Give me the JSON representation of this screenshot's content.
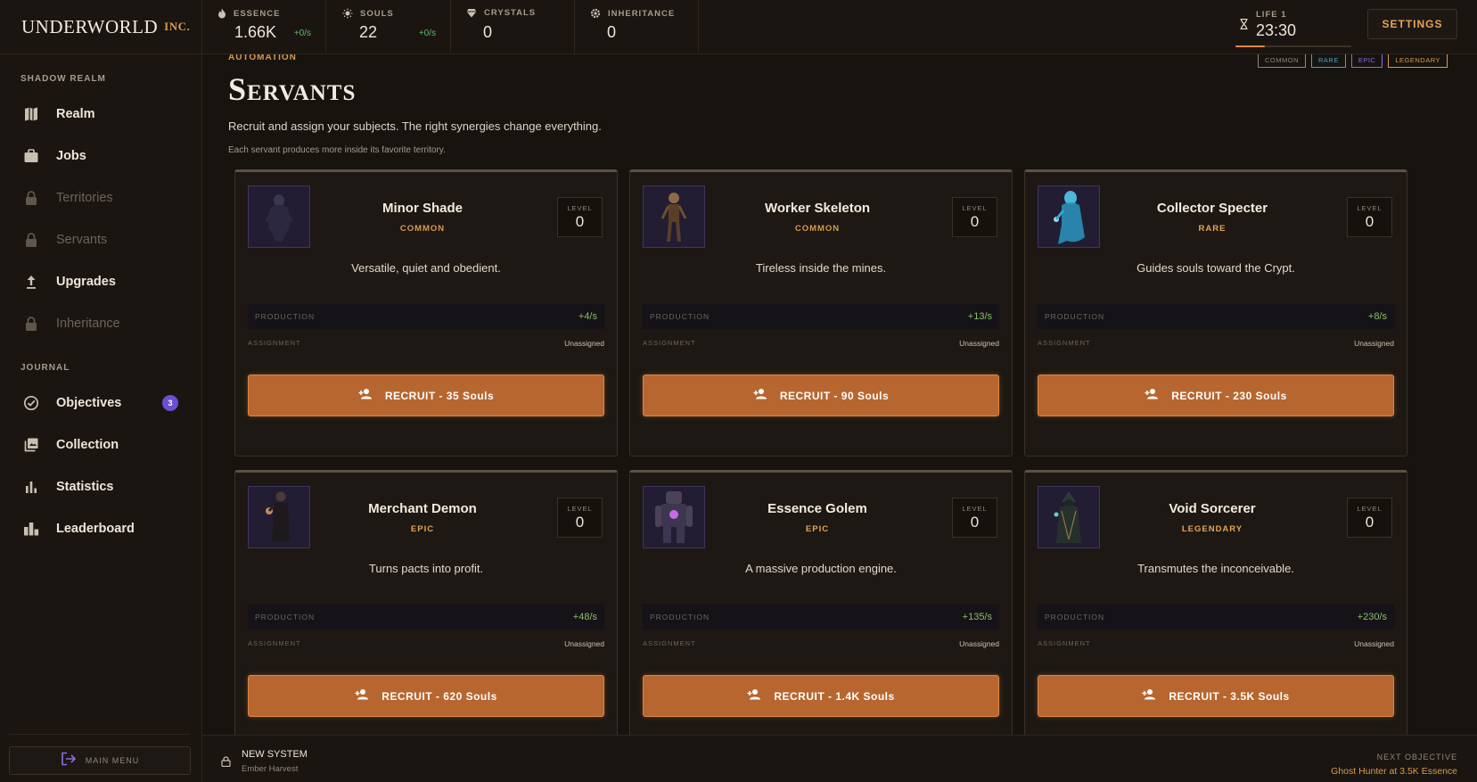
{
  "brand": {
    "main": "UNDERWORLD",
    "inc": "INC."
  },
  "nav": {
    "section1": "SHADOW REALM",
    "section2": "JOURNAL",
    "items": [
      {
        "label": "Realm",
        "icon": "map-icon",
        "locked": false
      },
      {
        "label": "Jobs",
        "icon": "briefcase-icon",
        "locked": false
      },
      {
        "label": "Territories",
        "icon": "lock-icon",
        "locked": true
      },
      {
        "label": "Servants",
        "icon": "lock-icon",
        "locked": true
      },
      {
        "label": "Upgrades",
        "icon": "upload-arrow-icon",
        "locked": false
      },
      {
        "label": "Inheritance",
        "icon": "lock-icon",
        "locked": true
      },
      {
        "label": "Objectives",
        "icon": "check-circle-icon",
        "locked": false,
        "badge": "3"
      },
      {
        "label": "Collection",
        "icon": "collection-icon",
        "locked": false
      },
      {
        "label": "Statistics",
        "icon": "bar-chart-icon",
        "locked": false
      },
      {
        "label": "Leaderboard",
        "icon": "leaderboard-icon",
        "locked": false
      }
    ],
    "main_menu": "MAIN MENU"
  },
  "resources": [
    {
      "name": "ESSENCE",
      "value": "1.66K",
      "rate": "+0/s",
      "icon": "flame-icon"
    },
    {
      "name": "SOULS",
      "value": "22",
      "rate": "+0/s",
      "icon": "sun-icon"
    },
    {
      "name": "CRYSTALS",
      "value": "0",
      "rate": "",
      "icon": "gem-icon"
    },
    {
      "name": "INHERITANCE",
      "value": "0",
      "rate": "",
      "icon": "gear-icon"
    }
  ],
  "life": {
    "label": "LIFE 1",
    "time": "23:30",
    "progress": 0.25
  },
  "settings_label": "SETTINGS",
  "page": {
    "kicker": "AUTOMATION",
    "title": "Servants",
    "subtitle": "Recruit and assign your subjects. The right synergies change everything.",
    "note": "Each servant produces more inside its favorite territory."
  },
  "legend": [
    {
      "label": "COMMON",
      "color": "#8f877b"
    },
    {
      "label": "RARE",
      "color": "#4f9fd6"
    },
    {
      "label": "EPIC",
      "color": "#8a6fe0"
    },
    {
      "label": "LEGENDARY",
      "color": "#d99a4f"
    }
  ],
  "labels": {
    "level": "LEVEL",
    "production": "PRODUCTION",
    "assignment": "ASSIGNMENT"
  },
  "servants": [
    {
      "name": "Minor Shade",
      "rarity": "COMMON",
      "level": "0",
      "desc": "Versatile, quiet and obedient.",
      "production": "+4/s",
      "assignment": "Unassigned",
      "recruit": "RECRUIT -  35 Souls"
    },
    {
      "name": "Worker Skeleton",
      "rarity": "COMMON",
      "level": "0",
      "desc": "Tireless inside the mines.",
      "production": "+13/s",
      "assignment": "Unassigned",
      "recruit": "RECRUIT -  90 Souls"
    },
    {
      "name": "Collector Specter",
      "rarity": "RARE",
      "level": "0",
      "desc": "Guides souls toward the Crypt.",
      "production": "+8/s",
      "assignment": "Unassigned",
      "recruit": "RECRUIT -  230 Souls"
    },
    {
      "name": "Merchant Demon",
      "rarity": "EPIC",
      "level": "0",
      "desc": "Turns pacts into profit.",
      "production": "+48/s",
      "assignment": "Unassigned",
      "recruit": "RECRUIT -  620 Souls"
    },
    {
      "name": "Essence Golem",
      "rarity": "EPIC",
      "level": "0",
      "desc": "A massive production engine.",
      "production": "+135/s",
      "assignment": "Unassigned",
      "recruit": "RECRUIT -  1.4K Souls"
    },
    {
      "name": "Void Sorcerer",
      "rarity": "LEGENDARY",
      "level": "0",
      "desc": "Transmutes the inconceivable.",
      "production": "+230/s",
      "assignment": "Unassigned",
      "recruit": "RECRUIT -  3.5K Souls"
    }
  ],
  "rarity_colors": {
    "COMMON": "#d99a4f",
    "RARE": "#e8a357",
    "EPIC": "#e8a357",
    "LEGENDARY": "#e8a357"
  },
  "bottom": {
    "system_title": "NEW SYSTEM",
    "system_sub": "Ember Harvest",
    "next_label": "NEXT OBJECTIVE",
    "next_value": "Ghost Hunter at 3.5K Essence"
  }
}
